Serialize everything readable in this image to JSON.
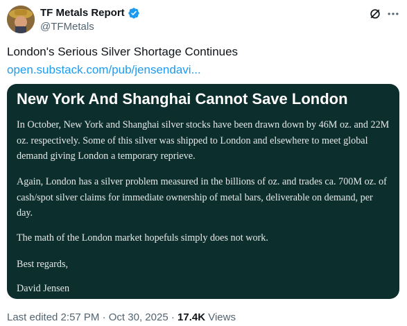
{
  "author": {
    "display_name": "TF Metals Report",
    "handle": "@TFMetals",
    "verified": true
  },
  "tweet": {
    "text": "London's Serious Silver Shortage Continues",
    "link": "open.substack.com/pub/jensendavi..."
  },
  "card": {
    "title": "New York And Shanghai Cannot Save London",
    "paragraphs": [
      "In October, New York and Shanghai silver stocks have been drawn down by 46M oz. and 22M oz. respectively. Some of this silver was shipped to London and elsewhere to meet global demand giving London a temporary reprieve.",
      "Again, London has a silver problem measured in the billions of oz. and trades ca. 700M oz. of cash/spot silver claims for immediate ownership of metal bars, deliverable on demand, per day.",
      "The math of the London market hopefuls simply does not work.",
      "Best regards,",
      "David Jensen"
    ]
  },
  "footer": {
    "edited": "Last edited 2:57 PM",
    "separator": "·",
    "date": "Oct 30, 2025",
    "views_count": "17.4K",
    "views_label": "Views"
  },
  "colors": {
    "card_bg": "#0c2e2d",
    "link": "#1d9bf0",
    "verified": "#1d9bf0",
    "muted": "#536471"
  },
  "icons": [
    "avatar",
    "verified-badge-icon",
    "grok-icon",
    "more-icon"
  ]
}
